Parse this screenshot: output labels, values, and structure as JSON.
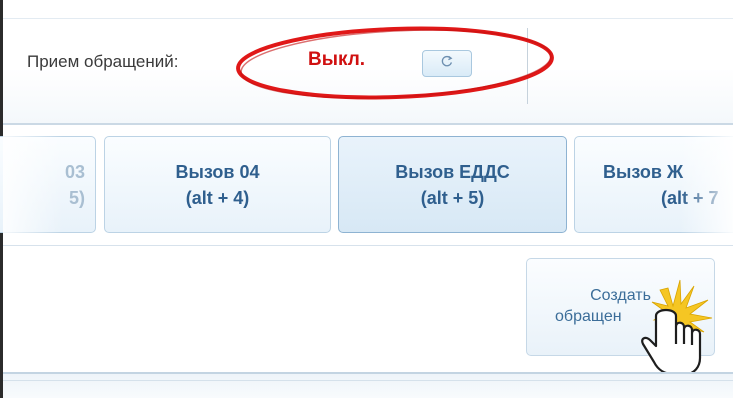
{
  "status": {
    "label": "Прием обращений:",
    "value": "Выкл.",
    "value_color": "#d01010",
    "refresh_icon": "refresh-icon"
  },
  "call_buttons": [
    {
      "line1": "03",
      "line2": "5)",
      "state": "faded"
    },
    {
      "line1": "Вызов 04",
      "line2": "(alt + 4)",
      "state": "normal"
    },
    {
      "line1": "Вызов ЕДДС",
      "line2": "(alt + 5)",
      "state": "active"
    },
    {
      "line1": "Вызов Ж",
      "line2": "(alt + 7",
      "state": "cut"
    }
  ],
  "create_request": {
    "line1": "Создать",
    "line2": "обращен"
  },
  "annotations": {
    "ellipse_color": "#e01818",
    "cursor_icon": "hand-pointer-icon",
    "click_burst_color": "#f0c419"
  },
  "colors": {
    "button_text": "#2f5f8e",
    "button_border": "#bcd3e5"
  }
}
